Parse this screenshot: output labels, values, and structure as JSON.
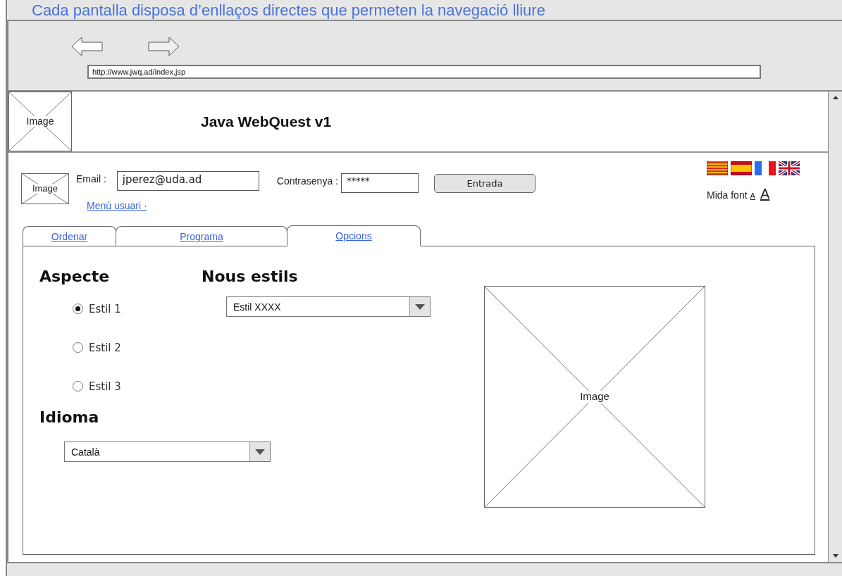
{
  "caption": "Cada pantalla disposa d’enllaços directes que permeten la navegació lliure",
  "browser": {
    "url": "http://www.jwq.ad/index.jsp"
  },
  "header": {
    "logo_label": "Image",
    "title": "Java WebQuest v1"
  },
  "login": {
    "avatar_label": "Image",
    "email_label": "Email :",
    "email_value": "jperez@uda.ad",
    "password_label": "Contrasenya :",
    "password_value": "*****",
    "button": "Entrada",
    "user_menu": "Menú usuari ·"
  },
  "languages": [
    {
      "kind": "catalan"
    },
    {
      "kind": "spanish"
    },
    {
      "kind": "french"
    },
    {
      "kind": "english"
    }
  ],
  "font_size": {
    "label": "Mida font",
    "small": "A",
    "large": "A"
  },
  "tabs": [
    {
      "label": "Ordenar",
      "selected": false
    },
    {
      "label": "Programa",
      "selected": false
    },
    {
      "label": "Opcions",
      "selected": true
    }
  ],
  "options": {
    "aspect_heading": "Aspecte",
    "styles": [
      {
        "label": "Estil 1",
        "selected": true
      },
      {
        "label": "Estil 2",
        "selected": false
      },
      {
        "label": "Estil 3",
        "selected": false
      }
    ],
    "new_styles_heading": "Nous estils",
    "new_style_value": "Estil XXXX",
    "language_heading": "Idioma",
    "language_value": "Català",
    "image_label": "Image"
  }
}
